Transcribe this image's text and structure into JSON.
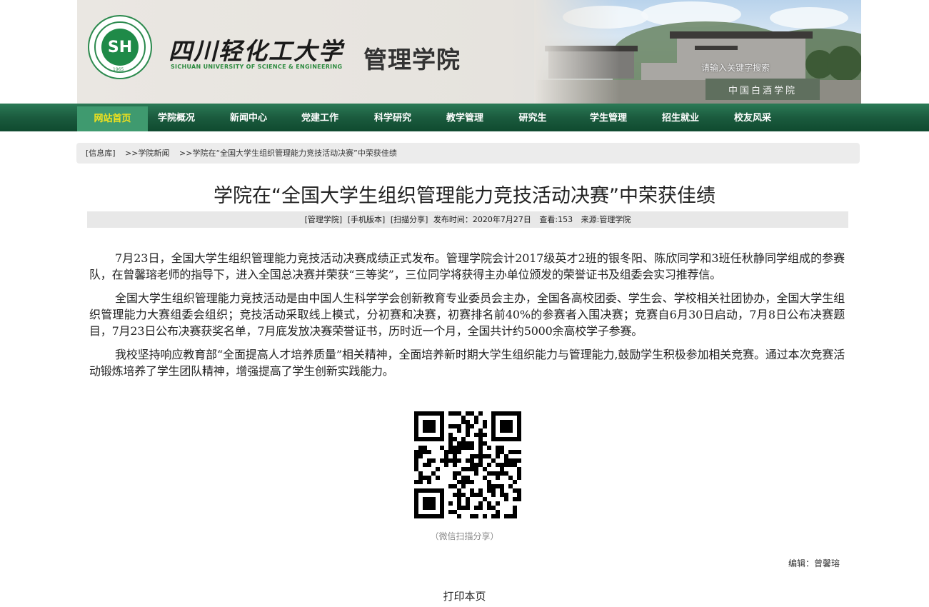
{
  "header": {
    "logo_year": "1965",
    "university_cn": "四川轻化工大学",
    "university_en": "SICHUAN UNIVERSITY OF SCIENCE & ENGINEERING",
    "college": "管理学院",
    "search_placeholder": "请输入关键字搜索",
    "banner_sign": "中国白酒学院"
  },
  "nav": [
    "网站首页",
    "学院概况",
    "新闻中心",
    "党建工作",
    "科学研究",
    "教学管理",
    "研究生",
    "学生管理",
    "招生就业",
    "校友风采"
  ],
  "nav_active_index": 0,
  "breadcrumb": [
    "[信息库]",
    ">>学院新闻",
    ">>学院在“全国大学生组织管理能力竞技活动决赛”中荣获佳绩"
  ],
  "article": {
    "title": "学院在“全国大学生组织管理能力竞技活动决赛”中荣获佳绩",
    "meta": {
      "source_tag": "[管理学院]",
      "mobile": "[手机版本]",
      "share": "[扫描分享]",
      "publish": "发布时间：2020年7月27日",
      "views": "查看:153",
      "origin": "来源:管理学院"
    },
    "paragraphs": [
      "7月23日，全国大学生组织管理能力竞技活动决赛成绩正式发布。管理学院会计2017级英才2班的银冬阳、陈欣同学和3班任秋静同学组成的参赛队，在曾馨瑢老师的指导下，进入全国总决赛并荣获“三等奖”，三位同学将获得主办单位颁发的荣誉证书及组委会实习推荐信。",
      "全国大学生组织管理能力竞技活动是由中国人生科学学会创新教育专业委员会主办，全国各高校团委、学生会、学校相关社团协办，全国大学生组织管理能力大赛组委会组织；竞技活动采取线上模式，分初赛和决赛，初赛排名前40%的参赛者入围决赛；竞赛自6月30日启动，7月8日公布决赛题目，7月23日公布决赛获奖名单，7月底发放决赛荣誉证书，历时近一个月，全国共计约5000余高校学子参赛。",
      "我校坚持响应教育部“全面提高人才培养质量”相关精神，全面培养新时期大学生组织能力与管理能力,鼓励学生积极参加相关竞赛。通过本次竞赛活动锻炼培养了学生团队精神，增强提高了学生创新实践能力。"
    ],
    "qr_caption": "（微信扫描分享）",
    "editor": "编辑：曾馨瑢",
    "print": "打印本页"
  }
}
